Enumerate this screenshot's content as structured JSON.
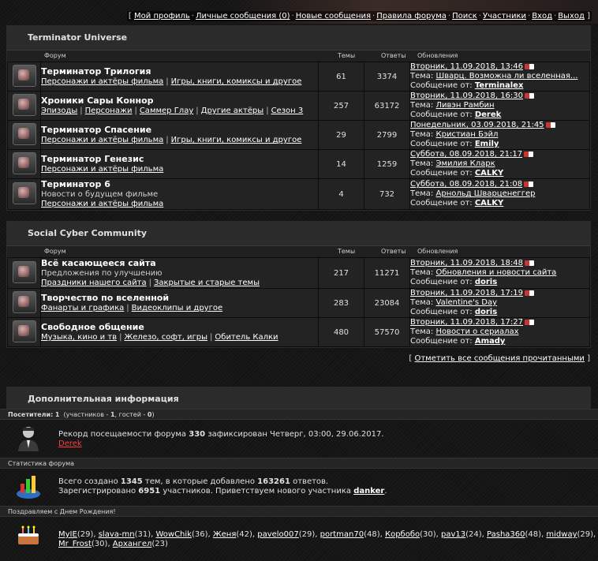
{
  "topnav": [
    "Мой профиль",
    "Личные сообщения (0)",
    "Новые сообщения",
    "Правила форума",
    "Поиск",
    "Участники",
    "Вход",
    "Выход"
  ],
  "columns": {
    "forum": "Форум",
    "topics": "Темы",
    "replies": "Ответы",
    "updates": "Обновления"
  },
  "categories": [
    {
      "title": "Terminator Universe",
      "forums": [
        {
          "title": "Терминатор Трилогия",
          "desc": "",
          "subs": [
            "Персонажи и актёры фильма",
            "Игры, книги, комиксы и другое"
          ],
          "topics": "61",
          "replies": "3374",
          "date": "Вторник, 11.09.2018, 13:46",
          "topic_label": "Тема:",
          "topic": "Шварц. Возможна ли вселенная...",
          "by_label": "Сообщение от:",
          "user": "Terminalex"
        },
        {
          "title": "Хроники Сары Коннор",
          "desc": "",
          "subs": [
            "Эпизоды",
            "Персонажи",
            "Саммер Глау",
            "Другие актёры",
            "Сезон 3"
          ],
          "topics": "257",
          "replies": "63172",
          "date": "Вторник, 11.09.2018, 16:30",
          "topic_label": "Тема:",
          "topic": "Ливэн Рамбин",
          "by_label": "Сообщение от:",
          "user": "Derek"
        },
        {
          "title": "Терминатор Спасение",
          "desc": "",
          "subs": [
            "Персонажи и актёры фильма",
            "Игры, книги, комиксы и другое"
          ],
          "topics": "29",
          "replies": "2799",
          "date": "Понедельник, 03.09.2018, 21:45",
          "topic_label": "Тема:",
          "topic": "Кристиан Бэйл",
          "by_label": "Сообщение от:",
          "user": "Emily"
        },
        {
          "title": "Терминатор Генезис",
          "desc": "",
          "subs": [
            "Персонажи и актёры фильма"
          ],
          "topics": "14",
          "replies": "1259",
          "date": "Суббота, 08.09.2018, 21:17",
          "topic_label": "Тема:",
          "topic": "Эмилия Кларк",
          "by_label": "Сообщение от:",
          "user": "CALKY"
        },
        {
          "title": "Терминатор 6",
          "desc": "Новости о будущем фильме",
          "subs": [
            "Персонажи и актёры фильма"
          ],
          "topics": "4",
          "replies": "732",
          "date": "Суббота, 08.09.2018, 21:08",
          "topic_label": "Тема:",
          "topic": "Арнольд Шварценеггер",
          "by_label": "Сообщение от:",
          "user": "CALKY"
        }
      ]
    },
    {
      "title": "Social Cyber Community",
      "forums": [
        {
          "title": "Всё касающееся сайта",
          "desc": "Предложения по улучшению",
          "subs": [
            "Праздники нашего сайта",
            "Закрытые и старые темы"
          ],
          "topics": "217",
          "replies": "11271",
          "date": "Вторник, 11.09.2018, 18:48",
          "topic_label": "Тема:",
          "topic": "Обновления и новости сайта",
          "by_label": "Сообщение от:",
          "user": "doris"
        },
        {
          "title": "Творчество по вселенной",
          "desc": "",
          "subs": [
            "Фанарты и графика",
            "Видеоклипы и другое"
          ],
          "topics": "283",
          "replies": "23084",
          "date": "Вторник, 11.09.2018, 17:19",
          "topic_label": "Тема:",
          "topic": "Valentine's Day",
          "by_label": "Сообщение от:",
          "user": "doris"
        },
        {
          "title": "Свободное общение",
          "desc": "",
          "subs": [
            "Музыка, кино и тв",
            "Железо, софт, игры",
            "Обитель Калки"
          ],
          "topics": "480",
          "replies": "57570",
          "date": "Вторник, 11.09.2018, 17:27",
          "topic_label": "Тема:",
          "topic": "Новости о сериалах",
          "by_label": "Сообщение от:",
          "user": "Amady"
        }
      ]
    }
  ],
  "mark_read": "Отметить все сообщения прочитанными",
  "info": {
    "title": "Дополнительная информация",
    "visitors_label": "Посетители:",
    "visitors_total": "1",
    "visitors_members_label": "участников -",
    "visitors_members": "1",
    "visitors_guests_label": "гостей -",
    "visitors_guests": "0",
    "record_pre": "Рекорд посещаемости форума",
    "record_num": "330",
    "record_post": "зафиксирован Четверг, 03:00, 29.06.2017.",
    "record_user": "Derek",
    "stats_label": "Статистика форума",
    "stats_l1_pre": "Всего создано",
    "stats_topics": "1345",
    "stats_l1_mid": "тем, в которые добавлено",
    "stats_posts": "163261",
    "stats_l1_post": "ответов.",
    "stats_l2_pre": "Зарегистрировано",
    "stats_users": "6951",
    "stats_l2_mid": "участников. Приветствуем нового участника",
    "stats_newuser": "danker",
    "bday_label": "Поздравляем с Днем Рождения!",
    "birthdays": [
      {
        "name": "MyIE",
        "age": "(29)"
      },
      {
        "name": "slava-mn",
        "age": "(31)"
      },
      {
        "name": "WowChik",
        "age": "(36)"
      },
      {
        "name": "Женя",
        "age": "(42)"
      },
      {
        "name": "pavelo007",
        "age": "(29)"
      },
      {
        "name": "portman70",
        "age": "(48)"
      },
      {
        "name": "Корбобо",
        "age": "(30)"
      },
      {
        "name": "pav13",
        "age": "(24)"
      },
      {
        "name": "Pasha360",
        "age": "(48)"
      },
      {
        "name": "midway",
        "age": "(29)"
      },
      {
        "name": "Mr_Frost",
        "age": "(30)"
      },
      {
        "name": "Архангел",
        "age": "(23)"
      }
    ]
  }
}
